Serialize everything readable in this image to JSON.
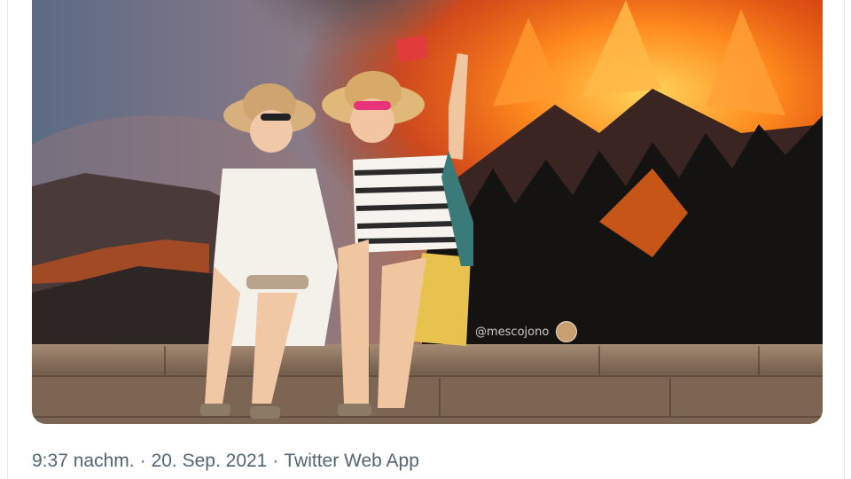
{
  "media": {
    "watermark": "@mescojono"
  },
  "tweet_meta": {
    "time": "9:37 nachm.",
    "separator": "·",
    "date": "20. Sep. 2021",
    "source": "Twitter Web App"
  },
  "colors": {
    "meta_text": "#536471",
    "border": "#e6e6e6"
  }
}
